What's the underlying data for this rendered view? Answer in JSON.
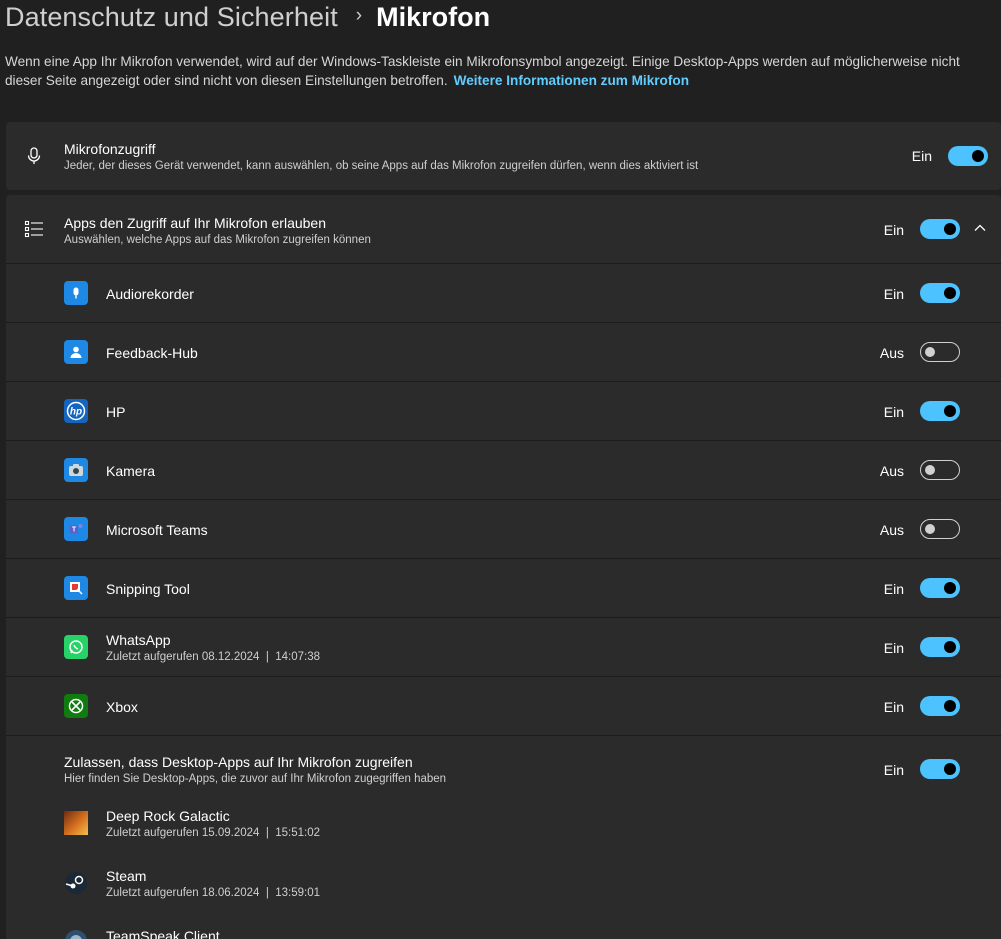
{
  "breadcrumb": {
    "parent": "Datenschutz und Sicherheit",
    "separator": "›",
    "current": "Mikrofon"
  },
  "description": {
    "text": "Wenn eine App Ihr Mikrofon verwendet, wird auf der Windows-Taskleiste ein Mikrofonsymbol angezeigt. Einige Desktop-Apps werden auf möglicherweise nicht dieser Seite angezeigt oder sind nicht von diesen Einstellungen betroffen.",
    "link": "Weitere Informationen zum Mikrofon"
  },
  "mic_access": {
    "icon": "microphone-icon",
    "title": "Mikrofonzugriff",
    "subtitle": "Jeder, der dieses Gerät verwendet, kann auswählen, ob seine Apps auf das Mikrofon zugreifen dürfen, wenn dies aktiviert ist",
    "state": "Ein",
    "on": true
  },
  "apps_access": {
    "icon": "list-icon",
    "title": "Apps den Zugriff auf Ihr Mikrofon erlauben",
    "subtitle": "Auswählen, welche Apps auf das Mikrofon zugreifen können",
    "state": "Ein",
    "on": true
  },
  "apps": [
    {
      "name": "Audiorekorder",
      "state": "Ein",
      "on": true,
      "icon": "audio-recorder-icon",
      "color": "#1e88e5"
    },
    {
      "name": "Feedback-Hub",
      "state": "Aus",
      "on": false,
      "icon": "feedback-hub-icon",
      "color": "#1e88e5"
    },
    {
      "name": "HP",
      "state": "Ein",
      "on": true,
      "icon": "hp-icon",
      "color": "#1565c0"
    },
    {
      "name": "Kamera",
      "state": "Aus",
      "on": false,
      "icon": "camera-icon",
      "color": "#1e88e5"
    },
    {
      "name": "Microsoft Teams",
      "state": "Aus",
      "on": false,
      "icon": "teams-icon",
      "color": "#1e88e5"
    },
    {
      "name": "Snipping Tool",
      "state": "Ein",
      "on": true,
      "icon": "snipping-tool-icon",
      "color": "#1e88e5"
    },
    {
      "name": "WhatsApp",
      "subtitle": "Zuletzt aufgerufen 08.12.2024  |  14:07:38",
      "state": "Ein",
      "on": true,
      "icon": "whatsapp-icon",
      "color": "#25d366"
    },
    {
      "name": "Xbox",
      "state": "Ein",
      "on": true,
      "icon": "xbox-icon",
      "color": "#107c10"
    }
  ],
  "desktop_apps": {
    "title": "Zulassen, dass Desktop-Apps auf Ihr Mikrofon zugreifen",
    "subtitle": "Hier finden Sie Desktop-Apps, die zuvor auf Ihr Mikrofon zugegriffen haben",
    "state": "Ein",
    "on": true,
    "items": [
      {
        "name": "Deep Rock Galactic",
        "subtitle": "Zuletzt aufgerufen 15.09.2024  |  15:51:02",
        "icon": "deep-rock-galactic-icon"
      },
      {
        "name": "Steam",
        "subtitle": "Zuletzt aufgerufen 18.06.2024  |  13:59:01",
        "icon": "steam-icon"
      },
      {
        "name": "TeamSpeak Client",
        "icon": "teamspeak-icon"
      }
    ]
  },
  "colors": {
    "accent": "#4cc2ff",
    "link": "#60cdff",
    "background": "#202020",
    "card": "#2b2b2b"
  }
}
